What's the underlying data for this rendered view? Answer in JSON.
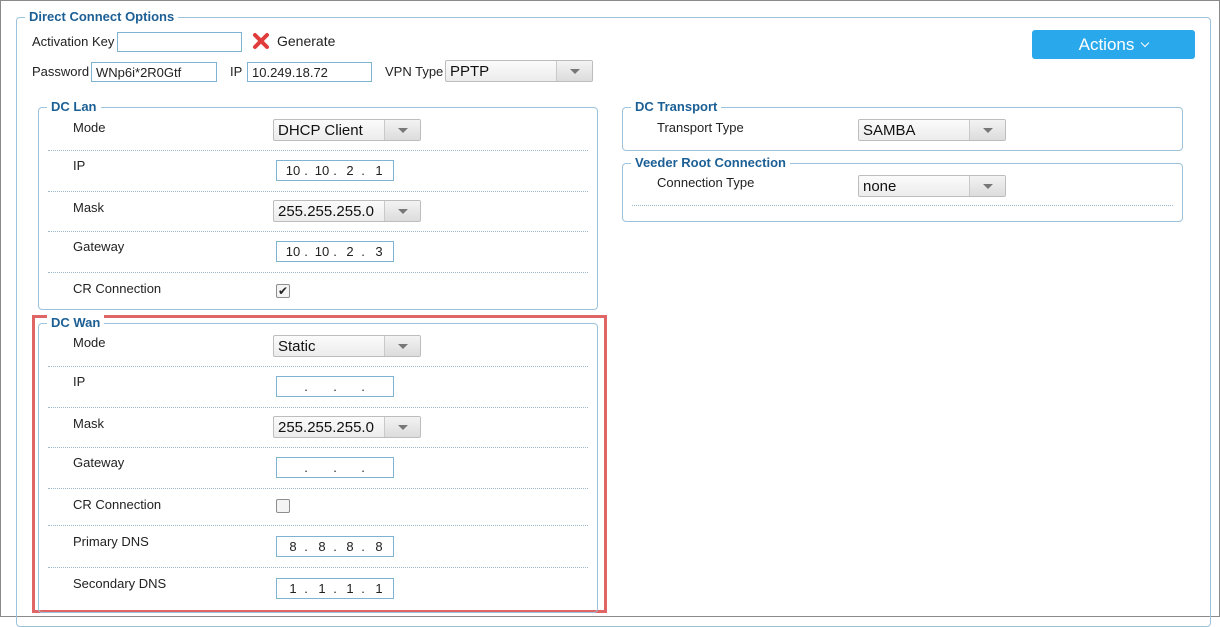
{
  "top": {
    "title": "Direct Connect Options",
    "activation_key_label": "Activation Key",
    "activation_key_value": "",
    "generate_label": "Generate",
    "password_label": "Password",
    "password_value": "WNp6i*2R0Gtf",
    "ip_label": "IP",
    "ip_value": "10.249.18.72",
    "vpn_type_label": "VPN Type",
    "vpn_type_value": "PPTP",
    "actions_label": "Actions"
  },
  "dc_lan": {
    "title": "DC Lan",
    "mode_label": "Mode",
    "mode_value": "DHCP Client",
    "ip_label": "IP",
    "ip": [
      "10",
      "10",
      "2",
      "1"
    ],
    "mask_label": "Mask",
    "mask_value": "255.255.255.0",
    "gateway_label": "Gateway",
    "gateway": [
      "10",
      "10",
      "2",
      "3"
    ],
    "cr_label": "CR Connection",
    "cr_checked": true,
    "cr_mark": "✔"
  },
  "dc_wan": {
    "title": "DC Wan",
    "mode_label": "Mode",
    "mode_value": "Static",
    "ip_label": "IP",
    "ip": [
      "",
      "",
      "",
      ""
    ],
    "mask_label": "Mask",
    "mask_value": "255.255.255.0",
    "gateway_label": "Gateway",
    "gateway": [
      "",
      "",
      "",
      ""
    ],
    "cr_label": "CR Connection",
    "cr_checked": false,
    "primary_dns_label": "Primary DNS",
    "primary_dns": [
      "8",
      "8",
      "8",
      "8"
    ],
    "secondary_dns_label": "Secondary DNS",
    "secondary_dns": [
      "1",
      "1",
      "1",
      "1"
    ]
  },
  "dc_transport": {
    "title": "DC Transport",
    "type_label": "Transport Type",
    "type_value": "SAMBA"
  },
  "veeder_root": {
    "title": "Veeder Root Connection",
    "type_label": "Connection Type",
    "type_value": "none"
  },
  "ip_dot": ".",
  "colors": {
    "accent": "#29a9ec",
    "legend": "#1c5f95",
    "highlight": "#e06666",
    "generate_x": "#e03c3c"
  }
}
